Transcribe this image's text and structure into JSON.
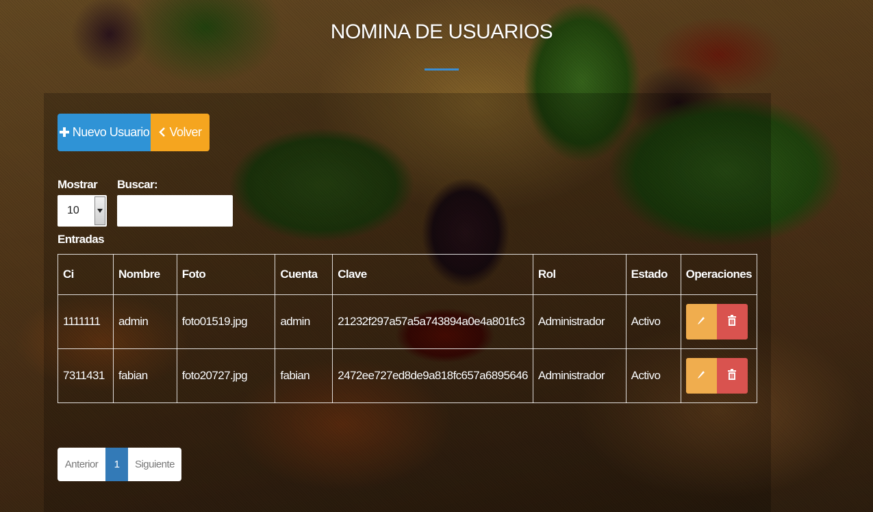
{
  "page": {
    "title": "NOMINA DE USUARIOS"
  },
  "toolbar": {
    "new_user_label": "Nuevo Usuario",
    "back_label": "Volver",
    "new_icon": "plus-icon",
    "back_icon": "chevron-left-icon"
  },
  "filters": {
    "show_label": "Mostrar",
    "page_size": "10",
    "search_label": "Buscar:",
    "search_value": "",
    "entries_label": "Entradas"
  },
  "table": {
    "headers": [
      "Ci",
      "Nombre",
      "Foto",
      "Cuenta",
      "Clave",
      "Rol",
      "Estado",
      "Operaciones"
    ],
    "rows": [
      {
        "ci": "1111111",
        "nombre": "admin",
        "foto": "foto01519.jpg",
        "cuenta": "admin",
        "clave": "21232f297a57a5a743894a0e4a801fc3",
        "rol": "Administrador",
        "estado": "Activo"
      },
      {
        "ci": "7311431",
        "nombre": "fabian",
        "foto": "foto20727.jpg",
        "cuenta": "fabian",
        "clave": "2472ee727ed8de9a818fc657a6895646",
        "rol": "Administrador",
        "estado": "Activo"
      }
    ],
    "edit_icon": "pencil-icon",
    "delete_icon": "trash-icon"
  },
  "pagination": {
    "prev_label": "Anterior",
    "current_page": "1",
    "next_label": "Siguiente"
  },
  "colors": {
    "primary": "#2f93d6",
    "warning": "#f5a51f",
    "edit": "#f0ad4e",
    "delete": "#d9534f",
    "active_page": "#337ab7",
    "title_underline": "#3a8ed6"
  }
}
